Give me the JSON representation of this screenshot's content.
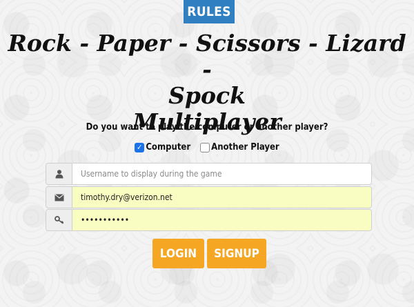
{
  "header": {
    "rules_label": "RULES"
  },
  "title": {
    "line1": "Rock - Paper - Scissors - Lizard -",
    "line2": "Spock",
    "line3": "Multiplayer"
  },
  "opponent": {
    "question": "Do you want to play the computer or another player?",
    "options": [
      {
        "label": "Computer",
        "checked": true
      },
      {
        "label": "Another Player",
        "checked": false
      }
    ]
  },
  "form": {
    "username": {
      "placeholder": "Username to display during the game",
      "value": "",
      "icon": "user-icon"
    },
    "email": {
      "value": "timothy.dry@verizon.net",
      "icon": "envelope-icon"
    },
    "password": {
      "value": "•••••••••••",
      "icon": "key-icon"
    }
  },
  "actions": {
    "login_label": "LOGIN",
    "signup_label": "SIGNUP"
  },
  "colors": {
    "rules_bg": "#2f7fc1",
    "action_bg": "#f5a623",
    "autofill_bg": "#fafdc2",
    "checkbox_checked": "#1a73e8"
  }
}
